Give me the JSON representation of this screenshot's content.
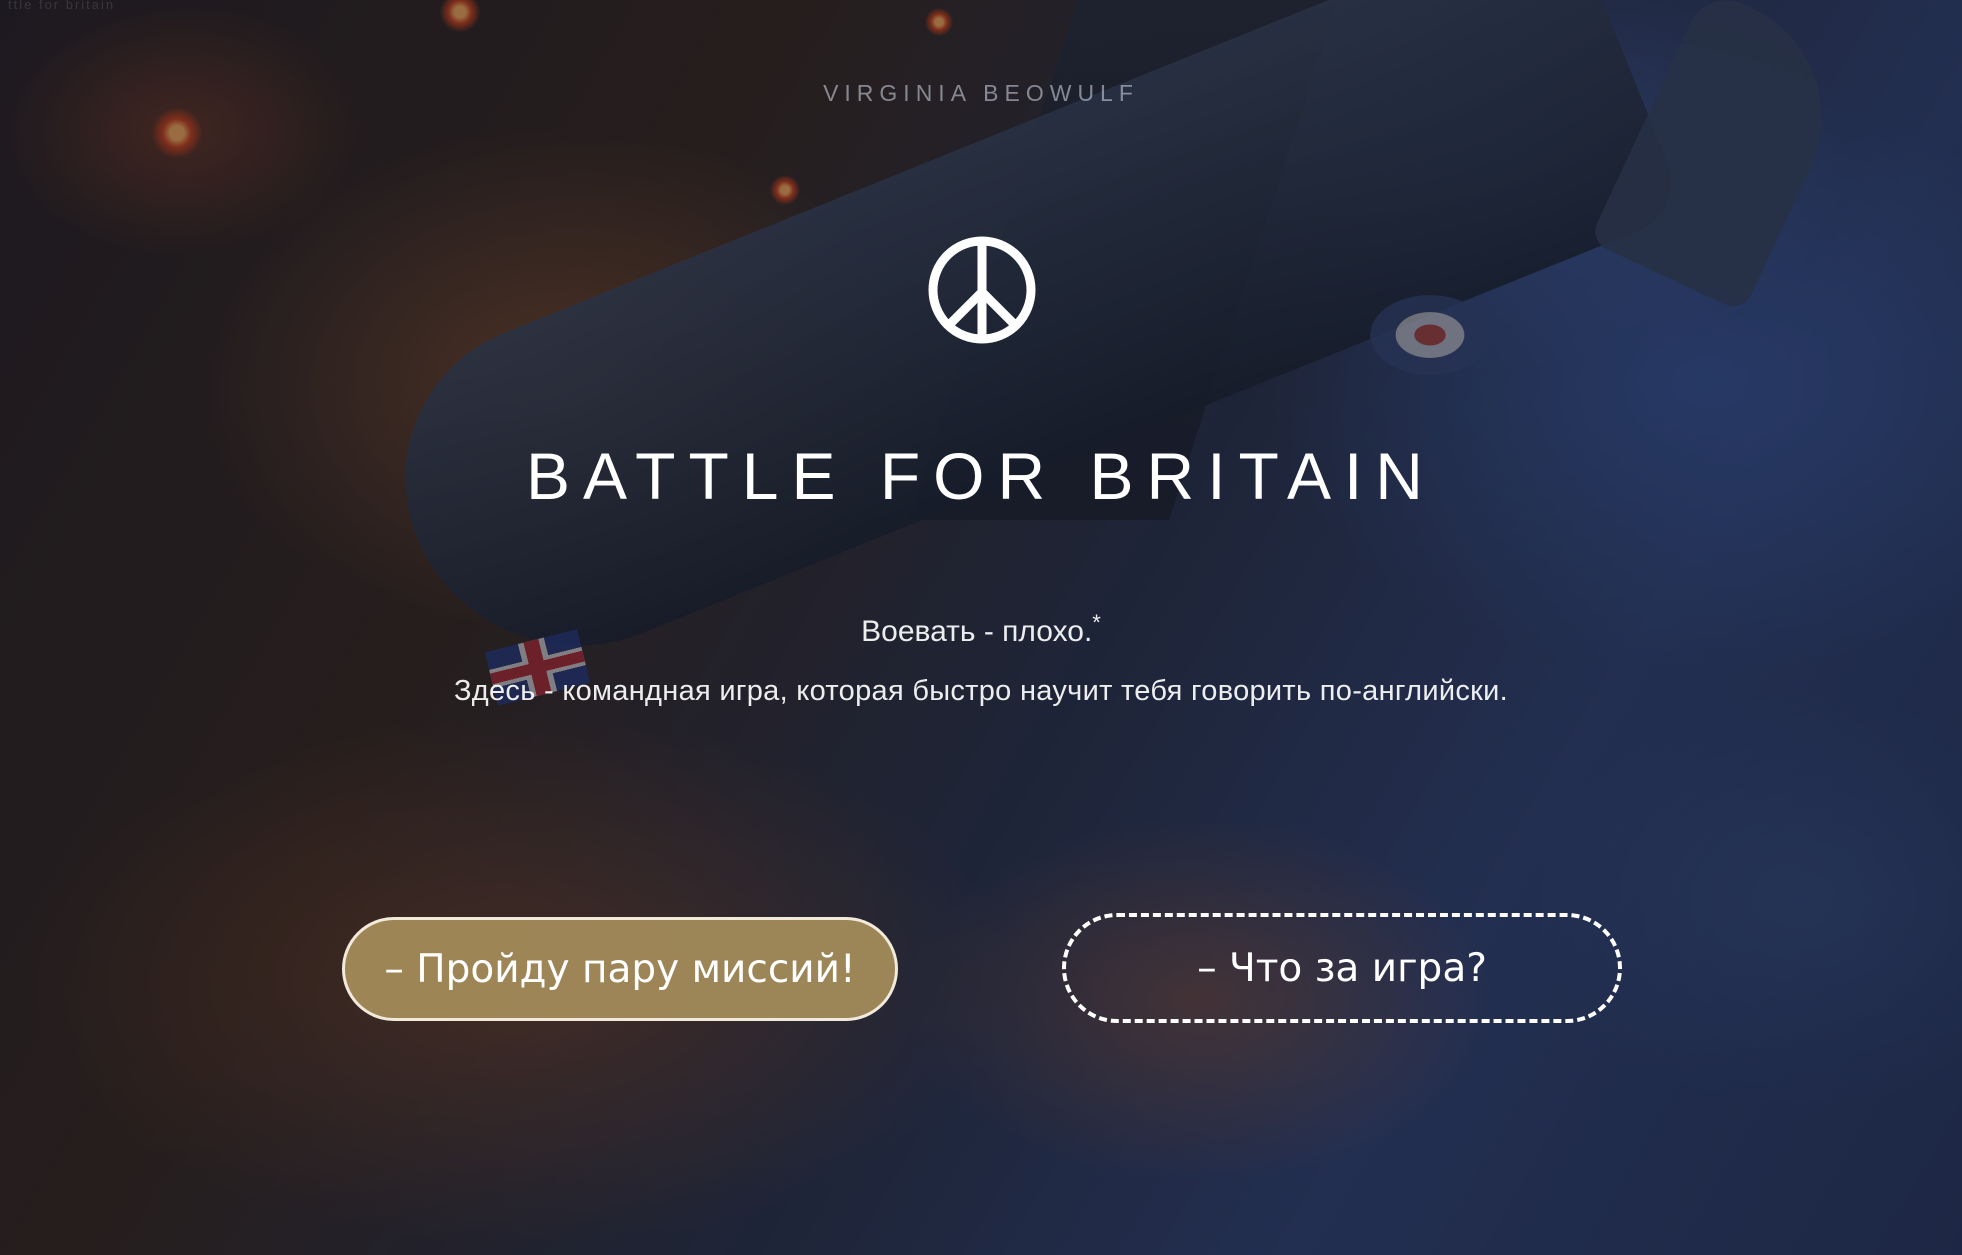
{
  "site": {
    "faint_top_label": "ttle for britain",
    "author": "VIRGINIA BEOWULF"
  },
  "hero": {
    "logo_icon": "peace-symbol-icon",
    "title": "BATTLE FOR BRITAIN",
    "tagline": "Воевать - плохо.",
    "tagline_mark": "*",
    "description": "Здесь - командная игра, которая быстро научит тебя говорить по-английски."
  },
  "actions": {
    "primary_label": "– Пройду пару миссий!",
    "secondary_label": "– Что за игра?"
  },
  "colors": {
    "primary_button_fill": "#a28a5a",
    "primary_button_border": "#f1eadb",
    "text": "#ffffff"
  }
}
